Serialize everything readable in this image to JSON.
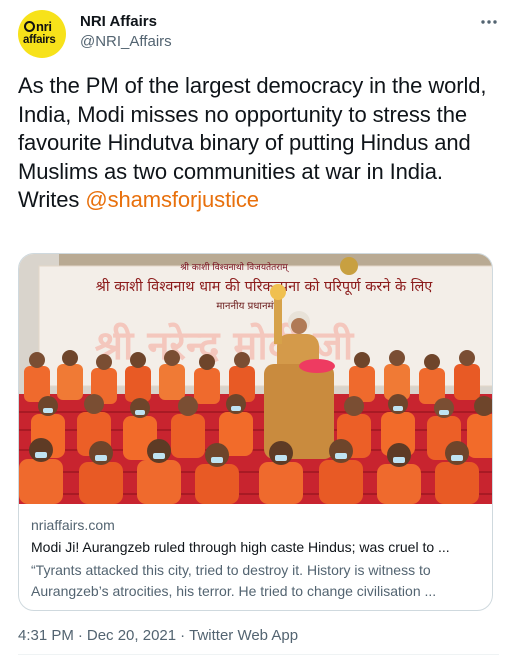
{
  "account": {
    "display_name": "NRI Affairs",
    "handle": "@NRI_Affairs",
    "avatar_line1": "nri",
    "avatar_line2": "affairs"
  },
  "tweet": {
    "text": "As the PM of the largest democracy in the world, India, Modi misses no opportunity to stress the favourite Hindutva binary of putting Hindus and Muslims as two communities at war in India. Writes ",
    "mention": "@shamsforjustice",
    "time": "4:31 PM",
    "date": "Dec 20, 2021",
    "source": "Twitter Web App",
    "separator": "·"
  },
  "card": {
    "banner_line1": "श्री काशी विश्वनाथो विजयतेतराम्",
    "banner_line2": "श्री काशी विश्वनाथ धाम की परिकल्पना को परिपूर्ण करने के लिए",
    "banner_line3": "माननीय प्रधानमंत्री",
    "banner_line4": "श्री नरेन्द्र मोदी जी",
    "domain": "nriaffairs.com",
    "title": "Modi Ji! Aurangzeb ruled through high caste Hindus; was cruel to ...",
    "description_line1": "“Tyrants attacked this city, tried to destroy it. History is witness to",
    "description_line2": "Aurangzeb’s atrocities, his terror. He tried to change civilisation ..."
  },
  "colors": {
    "mention": "#e8700c",
    "secondary_text": "#536471",
    "avatar_bg": "#f7e21a",
    "card_border": "#cfd9de"
  },
  "icons": {
    "more": "more-horizontal-icon"
  }
}
